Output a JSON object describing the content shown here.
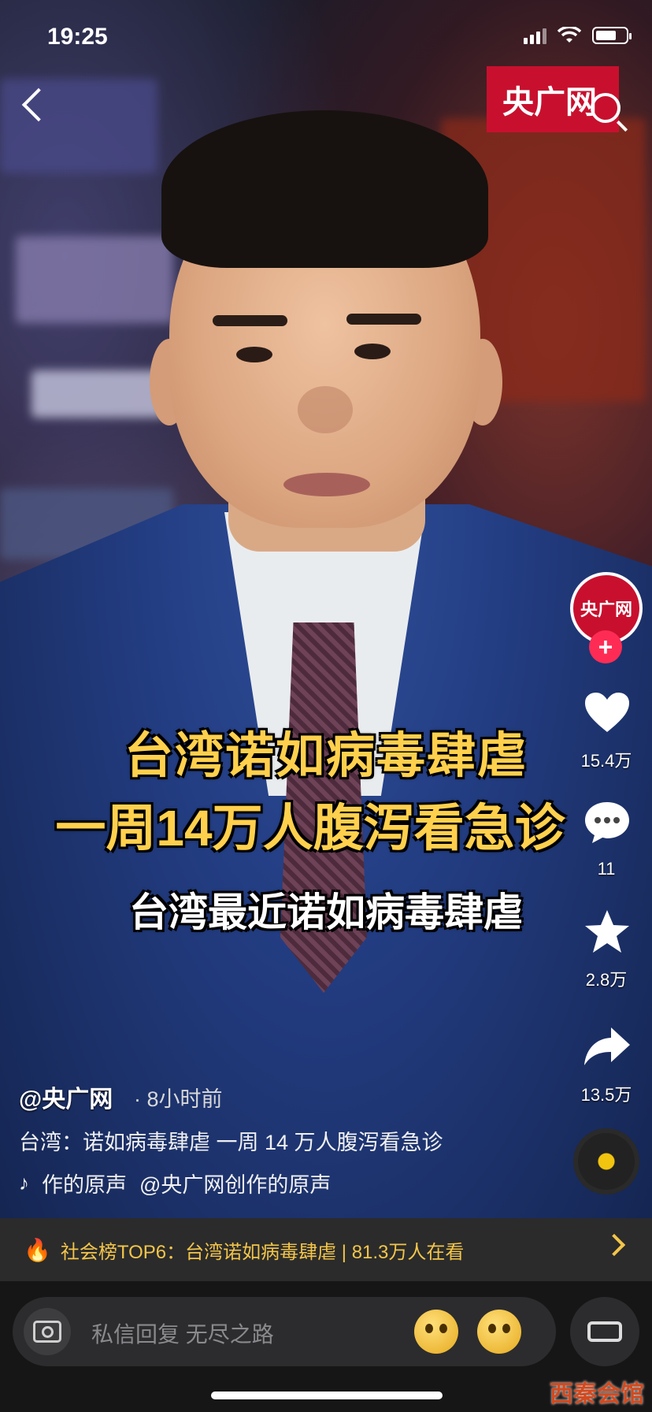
{
  "status_bar": {
    "time": "19:25"
  },
  "header": {
    "brand_logo": "央广网"
  },
  "video": {
    "caption_line1": "台湾诺如病毒肆虐",
    "caption_line2": "一周14万人腹泻看急诊",
    "subtitle": "台湾最近诺如病毒肆虐"
  },
  "rail": {
    "avatar_text": "央广网",
    "follow": "+",
    "likes": "15.4万",
    "comments": "11",
    "favorites": "2.8万",
    "shares": "13.5万"
  },
  "post": {
    "author": "@央广网",
    "time_ago": "· 8小时前",
    "description": "台湾：诺如病毒肆虐 一周 14 万人腹泻看急诊",
    "music_left": "作的原声",
    "music_right": "@央广网创作的原声"
  },
  "hot": {
    "text": "社会榜TOP6：台湾诺如病毒肆虐 | 81.3万人在看"
  },
  "comment_bar": {
    "placeholder": "私信回复 无尽之路"
  },
  "watermark": "西秦会馆"
}
